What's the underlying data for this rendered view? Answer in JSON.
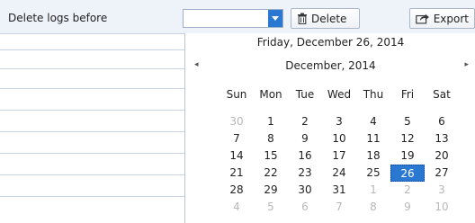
{
  "filter": {
    "label": "Delete logs before",
    "date_value": ""
  },
  "toolbar": {
    "delete_label": "Delete",
    "export_label": "Export"
  },
  "calendar": {
    "selected_date_text": "Friday, December 26, 2014",
    "month_label": "December, 2014",
    "prev_icon": "◂",
    "next_icon": "▸",
    "weekdays": [
      "Sun",
      "Mon",
      "Tue",
      "Wed",
      "Thu",
      "Fri",
      "Sat"
    ],
    "days": [
      {
        "d": "30",
        "muted": true
      },
      {
        "d": "1"
      },
      {
        "d": "2"
      },
      {
        "d": "3"
      },
      {
        "d": "4"
      },
      {
        "d": "5"
      },
      {
        "d": "6"
      },
      {
        "d": "7"
      },
      {
        "d": "8"
      },
      {
        "d": "9"
      },
      {
        "d": "10"
      },
      {
        "d": "11"
      },
      {
        "d": "12"
      },
      {
        "d": "13"
      },
      {
        "d": "14"
      },
      {
        "d": "15"
      },
      {
        "d": "16"
      },
      {
        "d": "17"
      },
      {
        "d": "18"
      },
      {
        "d": "19"
      },
      {
        "d": "20"
      },
      {
        "d": "21"
      },
      {
        "d": "22"
      },
      {
        "d": "23"
      },
      {
        "d": "24"
      },
      {
        "d": "25"
      },
      {
        "d": "26",
        "selected": true
      },
      {
        "d": "27"
      },
      {
        "d": "28"
      },
      {
        "d": "29"
      },
      {
        "d": "30"
      },
      {
        "d": "31"
      },
      {
        "d": "1",
        "muted": true
      },
      {
        "d": "2",
        "muted": true
      },
      {
        "d": "3",
        "muted": true
      },
      {
        "d": "4",
        "muted": true
      },
      {
        "d": "5",
        "muted": true
      },
      {
        "d": "6",
        "muted": true
      },
      {
        "d": "7",
        "muted": true
      },
      {
        "d": "8",
        "muted": true
      },
      {
        "d": "9",
        "muted": true
      },
      {
        "d": "10",
        "muted": true
      }
    ]
  },
  "colors": {
    "accent": "#2a78d2",
    "muted_text": "#b8b8b8"
  }
}
